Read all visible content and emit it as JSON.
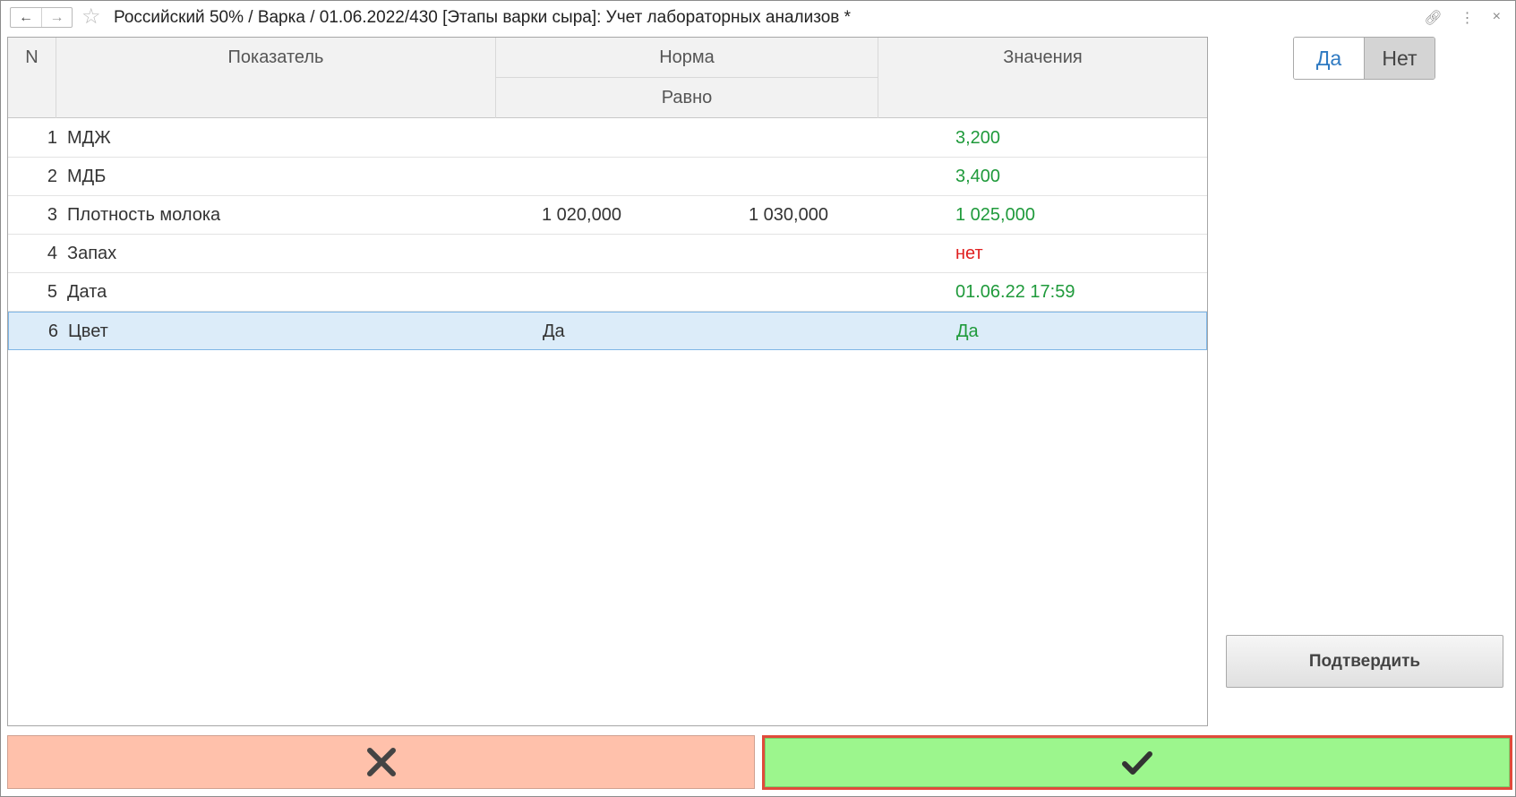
{
  "window": {
    "title": "Российский 50% / Варка / 01.06.2022/430 [Этапы варки сыра]: Учет лабораторных анализов *"
  },
  "table": {
    "headers": {
      "n": "N",
      "indicator": "Показатель",
      "norm": "Норма",
      "norm_sub": "Равно",
      "values": "Значения"
    },
    "rows": [
      {
        "n": "1",
        "name": "МДЖ",
        "min": "",
        "max": "",
        "value": "3,200",
        "status": "ok"
      },
      {
        "n": "2",
        "name": "МДБ",
        "min": "",
        "max": "",
        "value": "3,400",
        "status": "ok"
      },
      {
        "n": "3",
        "name": "Плотность молока",
        "min": "1 020,000",
        "max": "1 030,000",
        "value": "1 025,000",
        "status": "ok"
      },
      {
        "n": "4",
        "name": "Запах",
        "min": "",
        "max": "",
        "value": "нет",
        "status": "bad"
      },
      {
        "n": "5",
        "name": "Дата",
        "min": "",
        "max": "",
        "value": "01.06.22 17:59",
        "status": "ok"
      },
      {
        "n": "6",
        "name": "Цвет",
        "min": "Да",
        "max": "",
        "value": "Да",
        "status": "ok",
        "selected": true
      }
    ]
  },
  "toggle": {
    "yes": "Да",
    "no": "Нет",
    "selected": "no"
  },
  "confirm_label": "Подтвердить",
  "colors": {
    "ok": "#1f9a3b",
    "bad": "#e02020",
    "cancel": "#ffc1ab",
    "accept": "#9cf68d"
  }
}
